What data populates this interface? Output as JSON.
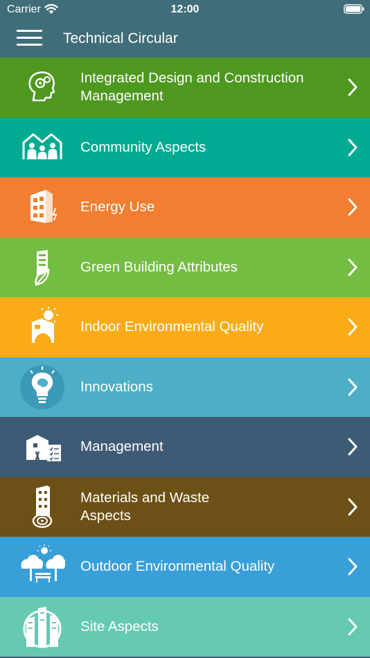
{
  "status_bar": {
    "carrier": "Carrier",
    "time": "12:00"
  },
  "nav": {
    "title": "Technical Circular",
    "menu_icon": "hamburger-menu-icon"
  },
  "items": [
    {
      "label": "Integrated Design and Construction Management",
      "color": "#4e9820",
      "icon": "head-gears-icon"
    },
    {
      "label": "Community Aspects",
      "color": "#00ab91",
      "icon": "community-people-icon"
    },
    {
      "label": "Energy Use",
      "color": "#f17e31",
      "icon": "building-energy-icon"
    },
    {
      "label": "Green Building Attributes",
      "color": "#74bd43",
      "icon": "building-leaf-icon"
    },
    {
      "label": "Indoor Environmental Quality",
      "color": "#fbab18",
      "icon": "sun-building-icon"
    },
    {
      "label": "Innovations",
      "color": "#4eaec6",
      "icon": "lightbulb-brain-icon"
    },
    {
      "label": "Management",
      "color": "#3d5b74",
      "icon": "building-checklist-icon"
    },
    {
      "label": "Materials and Waste Aspects",
      "color": "#6c5016",
      "icon": "building-log-icon"
    },
    {
      "label": "Outdoor Environmental Quality",
      "color": "#389fd9",
      "icon": "trees-bench-icon"
    },
    {
      "label": "Site Aspects",
      "color": "#66c9b2",
      "icon": "city-globe-icon"
    }
  ]
}
